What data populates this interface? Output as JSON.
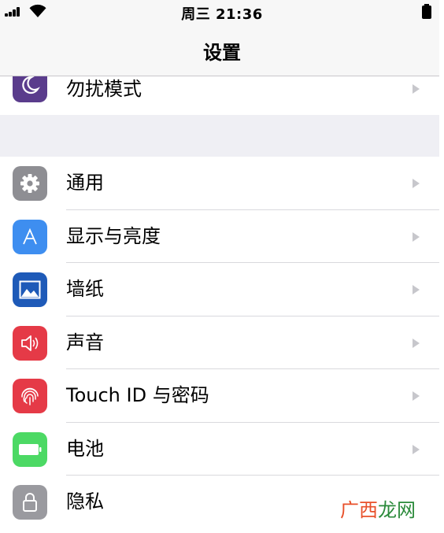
{
  "status_bar": {
    "clock": "周三  21:36"
  },
  "nav": {
    "title": "设置"
  },
  "group1": [
    {
      "label": "勿扰模式",
      "icon": "moon-icon",
      "icon_color": "#5a3c8c"
    }
  ],
  "group2": [
    {
      "label": "通用",
      "icon": "gear-icon",
      "icon_color": "#8e8e93"
    },
    {
      "label": "显示与亮度",
      "icon": "text-size-icon",
      "icon_color": "#3e8ef0"
    },
    {
      "label": "墙纸",
      "icon": "wallpaper-icon",
      "icon_color": "#1e5ab8"
    },
    {
      "label": "声音",
      "icon": "speaker-icon",
      "icon_color": "#e53a47"
    },
    {
      "label": "Touch ID 与密码",
      "icon": "fingerprint-icon",
      "icon_color": "#e53a47"
    },
    {
      "label": "电池",
      "icon": "battery-icon",
      "icon_color": "#4cd964"
    },
    {
      "label": "隐私",
      "icon": "lock-icon",
      "icon_color": "#9a9a9f"
    }
  ],
  "watermark": {
    "part1": "广西",
    "part1_color": "#e8502a",
    "part2": "龙网",
    "part2_color": "#2a8a3a"
  }
}
